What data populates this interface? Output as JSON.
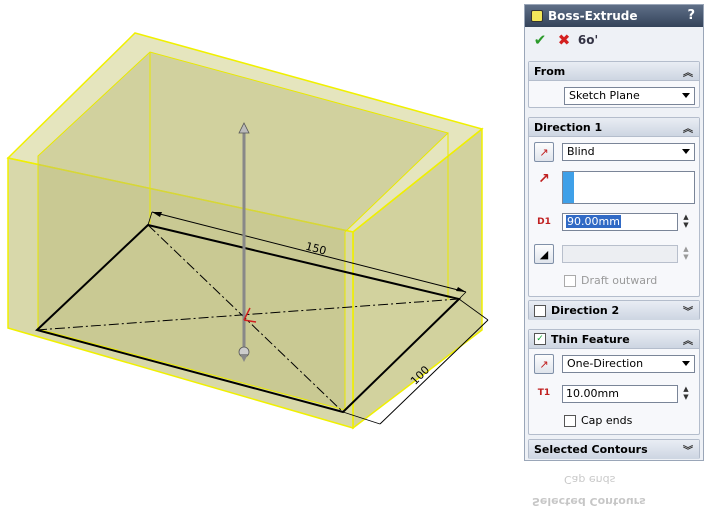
{
  "viewport": {
    "dimension_length": "150",
    "dimension_width": "100",
    "colors": {
      "body_fill": "#c9c98a",
      "body_edge": "#f0f000",
      "sketch": "#000000"
    }
  },
  "feature_manager": {
    "title": "Boss-Extrude",
    "help": "?",
    "actions": {
      "ok": "✔",
      "cancel": "✖",
      "preview": "6o'"
    },
    "from": {
      "label": "From",
      "value": "Sketch Plane"
    },
    "direction1": {
      "label": "Direction 1",
      "end_condition": "Blind",
      "depth": "90.00mm",
      "depth_icon": "D1",
      "draft_label": "Draft outward"
    },
    "direction2": {
      "label": "Direction 2"
    },
    "thin_feature": {
      "label": "Thin Feature",
      "type": "One-Direction",
      "thickness": "10.00mm",
      "thickness_icon": "T1",
      "cap_ends_label": "Cap ends"
    },
    "selected_contours": {
      "label": "Selected Contours"
    }
  }
}
